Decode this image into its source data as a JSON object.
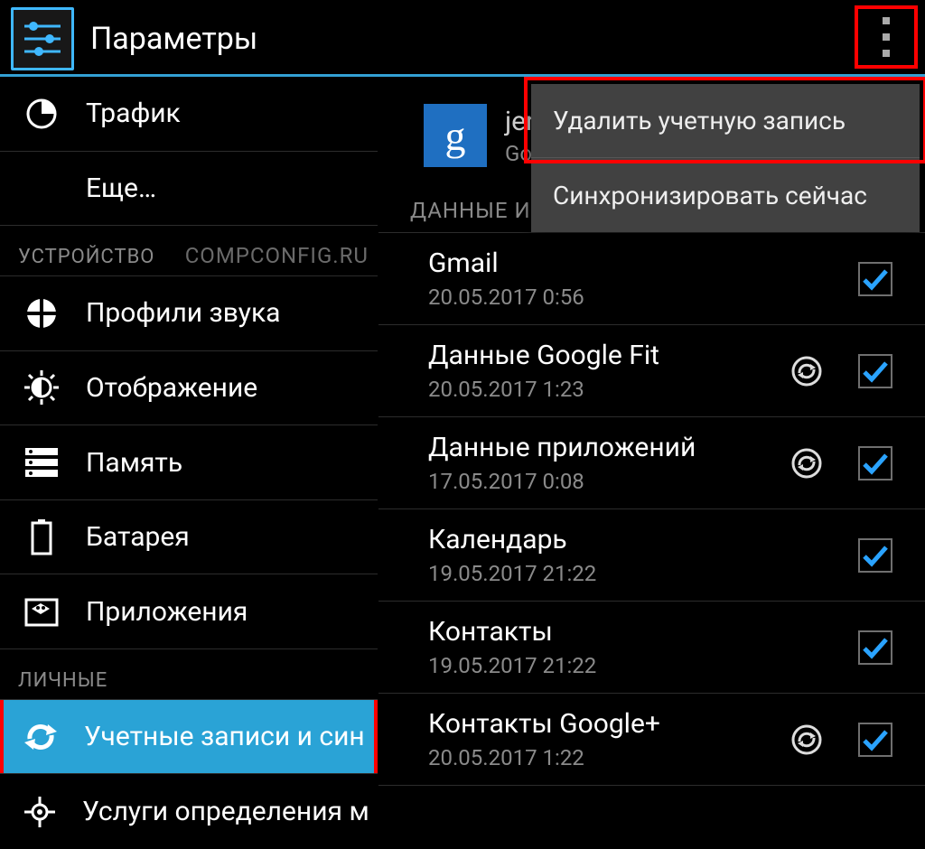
{
  "titlebar": {
    "title": "Параметры"
  },
  "sidebar": {
    "items": [
      {
        "label": "Трафик",
        "icon": "traffic"
      },
      {
        "label": "Еще…",
        "icon": ""
      }
    ],
    "section_device": "УСТРОЙСТВО",
    "watermark": "COMPCONFIG.RU",
    "device_items": [
      {
        "label": "Профили звука",
        "icon": "sound"
      },
      {
        "label": "Отображение",
        "icon": "display"
      },
      {
        "label": "Память",
        "icon": "storage"
      },
      {
        "label": "Батарея",
        "icon": "battery"
      },
      {
        "label": "Приложения",
        "icon": "apps"
      }
    ],
    "section_personal": "ЛИЧНЫЕ",
    "personal_items": [
      {
        "label": "Учетные записи и син",
        "icon": "sync",
        "active": true
      },
      {
        "label": "Услуги определения м",
        "icon": "location"
      }
    ]
  },
  "account": {
    "name_truncated": "jer",
    "provider_truncated": "Go",
    "section_label": "ДАННЫЕ И",
    "sync_items": [
      {
        "title": "Gmail",
        "date": "20.05.2017 0:56",
        "refresh": false
      },
      {
        "title": "Данные Google Fit",
        "date": "20.05.2017 1:23",
        "refresh": true
      },
      {
        "title": "Данные приложений",
        "date": "17.05.2017 0:08",
        "refresh": true
      },
      {
        "title": "Календарь",
        "date": "19.05.2017 21:22",
        "refresh": false
      },
      {
        "title": "Контакты",
        "date": "19.05.2017 21:22",
        "refresh": false
      },
      {
        "title": "Контакты Google+",
        "date": "20.05.2017 1:22",
        "refresh": true
      }
    ]
  },
  "popup": {
    "items": [
      {
        "label": "Удалить учетную запись"
      },
      {
        "label": "Синхронизировать сейчас"
      }
    ]
  },
  "colors": {
    "accent": "#2aa3d6",
    "check": "#2aa3ff"
  }
}
